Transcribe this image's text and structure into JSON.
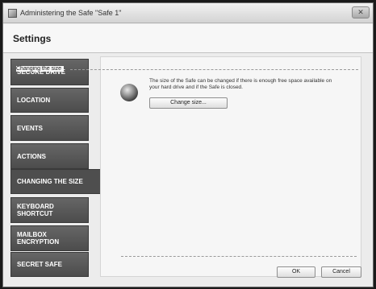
{
  "window": {
    "title": "Administering the Safe \"Safe 1\"",
    "close_glyph": "✕"
  },
  "header": {
    "title": "Settings"
  },
  "nav": {
    "items": [
      {
        "label": "Secure drive",
        "active": false
      },
      {
        "label": "Location",
        "active": false
      },
      {
        "label": "Events",
        "active": false
      },
      {
        "label": "Actions",
        "active": false
      },
      {
        "label": "Changing the size",
        "active": true
      },
      {
        "label": "Keyboard shortcut",
        "active": false
      },
      {
        "label": "Mailbox encryption",
        "active": false
      },
      {
        "label": "Secret Safe",
        "active": false
      }
    ]
  },
  "content": {
    "group_label": "Changing the size",
    "description": "The size of the Safe can be changed if there is enough free space available on your hard drive and if the Safe is closed.",
    "change_size_label": "Change size...",
    "icon": "sphere-icon"
  },
  "footer": {
    "ok_label": "OK",
    "cancel_label": "Cancel"
  }
}
